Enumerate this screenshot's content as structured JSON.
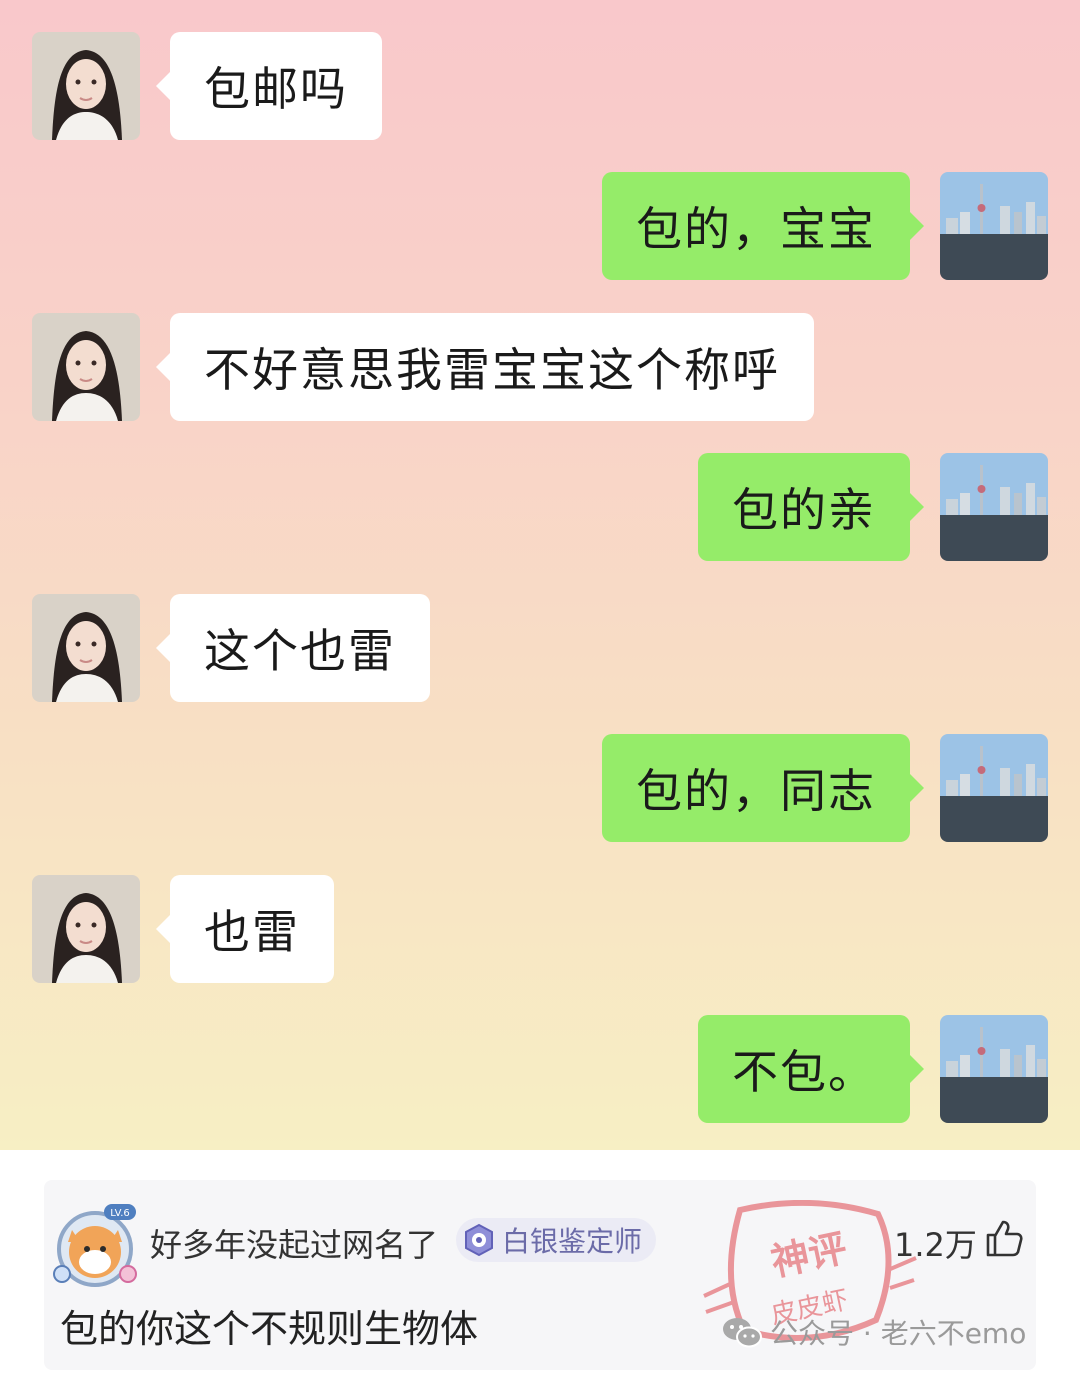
{
  "chat": {
    "messages": [
      {
        "side": "left",
        "text": "包邮吗"
      },
      {
        "side": "right",
        "text": "包的，宝宝"
      },
      {
        "side": "left",
        "text": "不好意思我雷宝宝这个称呼"
      },
      {
        "side": "right",
        "text": "包的亲"
      },
      {
        "side": "left",
        "text": "这个也雷"
      },
      {
        "side": "right",
        "text": "包的，同志"
      },
      {
        "side": "left",
        "text": "也雷"
      },
      {
        "side": "right",
        "text": "不包。"
      }
    ]
  },
  "comment": {
    "username": "好多年没起过网名了",
    "badge": "白银鉴定师",
    "level": "LV.6",
    "likes": "1.2万",
    "text": "包的你这个不规则生物体"
  },
  "watermark": {
    "stamp_top": "神评",
    "stamp_bottom": "皮皮虾",
    "text": "公众号 · 老六不emo"
  },
  "colors": {
    "bubble_right": "#95ec69",
    "bubble_left": "#ffffff",
    "badge_text": "#6b6ba8"
  }
}
